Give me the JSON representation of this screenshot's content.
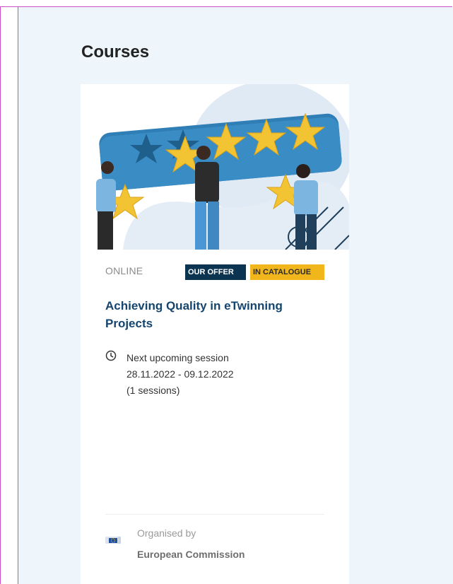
{
  "page": {
    "title": "Courses"
  },
  "course": {
    "mode": "ONLINE",
    "badges": {
      "offer": "OUR OFFER",
      "catalogue": "IN CATALOGUE"
    },
    "title": "Achieving Quality in eTwinning Projects",
    "session": {
      "label": "Next upcoming session",
      "dates": "28.11.2022 - 09.12.2022",
      "count": "(1 sessions)"
    },
    "organiser": {
      "label": "Organised by",
      "name": "European Commission"
    },
    "hero_image": {
      "icon": "rating-stars-illustration",
      "stars_rating": 5
    }
  },
  "colors": {
    "panel_bg": "#eef5fb",
    "title_blue": "#15456e",
    "badge_offer": "#0b3451",
    "badge_catalogue": "#f2b61d",
    "star_gold": "#f2c332",
    "rating_bar": "#2f7eb6"
  }
}
